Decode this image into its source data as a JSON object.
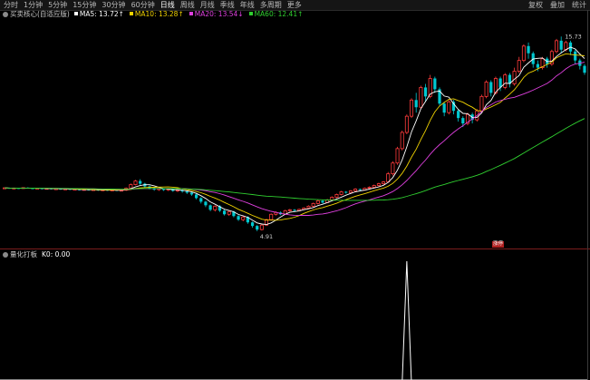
{
  "toolbar": {
    "timeframes": [
      "分时",
      "1分钟",
      "5分钟",
      "15分钟",
      "30分钟",
      "60分钟",
      "日线",
      "周线",
      "月线",
      "季线",
      "年线",
      "多周期",
      "更多"
    ],
    "active_index": 6,
    "right_buttons": [
      "复权",
      "叠加",
      "统计"
    ]
  },
  "main_legend": {
    "title": "买卖核心(自适应版)",
    "items": [
      {
        "label": "MA5: 13.72",
        "arrow": "↑",
        "color": "#ffffff"
      },
      {
        "label": "MA10: 13.28",
        "arrow": "↑",
        "color": "#f0d200"
      },
      {
        "label": "MA20: 13.54",
        "arrow": "↓",
        "color": "#e040e0"
      },
      {
        "label": "MA60: 12.41",
        "arrow": "↑",
        "color": "#30d030"
      }
    ]
  },
  "sub_legend": {
    "title": "量化打板",
    "value": "K0: 0.00"
  },
  "annotations": {
    "high_label": "15.73",
    "low_label": "4.91",
    "signal_badge": "涨停"
  },
  "colors": {
    "up": "#ff3b3b",
    "down": "#00c8d0",
    "ma5": "#ffffff",
    "ma10": "#f0d200",
    "ma20": "#e040e0",
    "ma60": "#30d030",
    "background": "#000000"
  },
  "chart_data": {
    "type": "candlestick",
    "price_range": [
      4.2,
      16.4
    ],
    "candles": [
      [
        7.3,
        7.32,
        7.26,
        7.34
      ],
      [
        7.32,
        7.29,
        7.27,
        7.34
      ],
      [
        7.29,
        7.31,
        7.27,
        7.33
      ],
      [
        7.31,
        7.28,
        7.26,
        7.32
      ],
      [
        7.28,
        7.33,
        7.27,
        7.35
      ],
      [
        7.33,
        7.3,
        7.28,
        7.35
      ],
      [
        7.3,
        7.27,
        7.25,
        7.31
      ],
      [
        7.27,
        7.3,
        7.25,
        7.32
      ],
      [
        7.3,
        7.26,
        7.24,
        7.31
      ],
      [
        7.26,
        7.29,
        7.24,
        7.3
      ],
      [
        7.29,
        7.25,
        7.23,
        7.3
      ],
      [
        7.25,
        7.27,
        7.22,
        7.29
      ],
      [
        7.27,
        7.23,
        7.21,
        7.28
      ],
      [
        7.23,
        7.26,
        7.21,
        7.27
      ],
      [
        7.26,
        7.22,
        7.2,
        7.27
      ],
      [
        7.22,
        7.24,
        7.19,
        7.26
      ],
      [
        7.24,
        7.2,
        7.18,
        7.25
      ],
      [
        7.2,
        7.23,
        7.18,
        7.24
      ],
      [
        7.23,
        7.19,
        7.17,
        7.24
      ],
      [
        7.19,
        7.22,
        7.17,
        7.23
      ],
      [
        7.22,
        7.18,
        7.15,
        7.23
      ],
      [
        7.18,
        7.21,
        7.16,
        7.22
      ],
      [
        7.21,
        7.17,
        7.15,
        7.22
      ],
      [
        7.17,
        7.2,
        7.14,
        7.21
      ],
      [
        7.2,
        7.16,
        7.14,
        7.21
      ],
      [
        7.16,
        7.19,
        7.13,
        7.2
      ],
      [
        7.19,
        7.3,
        7.15,
        7.34
      ],
      [
        7.3,
        7.5,
        7.26,
        7.56
      ],
      [
        7.5,
        7.7,
        7.46,
        7.76
      ],
      [
        7.7,
        7.55,
        7.48,
        7.8
      ],
      [
        7.55,
        7.4,
        7.35,
        7.6
      ],
      [
        7.4,
        7.3,
        7.24,
        7.45
      ],
      [
        7.3,
        7.22,
        7.16,
        7.35
      ],
      [
        7.22,
        7.28,
        7.15,
        7.32
      ],
      [
        7.28,
        7.2,
        7.15,
        7.3
      ],
      [
        7.2,
        7.25,
        7.14,
        7.28
      ],
      [
        7.25,
        7.15,
        7.1,
        7.27
      ],
      [
        7.15,
        7.2,
        7.08,
        7.22
      ],
      [
        7.2,
        7.12,
        7.05,
        7.24
      ],
      [
        7.12,
        7.05,
        6.98,
        7.16
      ],
      [
        7.05,
        6.95,
        6.88,
        7.1
      ],
      [
        6.95,
        6.75,
        6.68,
        7.0
      ],
      [
        6.75,
        6.55,
        6.45,
        6.8
      ],
      [
        6.55,
        6.35,
        6.25,
        6.6
      ],
      [
        6.35,
        6.1,
        6.02,
        6.4
      ],
      [
        6.1,
        6.3,
        6.0,
        6.35
      ],
      [
        6.3,
        6.05,
        5.98,
        6.36
      ],
      [
        6.05,
        5.85,
        5.78,
        6.1
      ],
      [
        5.85,
        6.0,
        5.76,
        6.05
      ],
      [
        6.0,
        5.75,
        5.68,
        6.04
      ],
      [
        5.75,
        5.55,
        5.48,
        5.8
      ],
      [
        5.55,
        5.7,
        5.46,
        5.76
      ],
      [
        5.7,
        5.4,
        5.32,
        5.74
      ],
      [
        5.4,
        5.2,
        5.1,
        5.45
      ],
      [
        5.2,
        5.0,
        4.91,
        5.25
      ],
      [
        5.0,
        5.25,
        4.95,
        5.3
      ],
      [
        5.25,
        5.55,
        5.2,
        5.6
      ],
      [
        5.55,
        5.85,
        5.5,
        5.9
      ],
      [
        5.85,
        5.95,
        5.78,
        6.02
      ],
      [
        5.95,
        5.85,
        5.8,
        6.0
      ],
      [
        5.85,
        6.05,
        5.82,
        6.1
      ],
      [
        6.05,
        6.1,
        6.0,
        6.15
      ],
      [
        6.1,
        6.05,
        6.0,
        6.14
      ],
      [
        6.05,
        6.12,
        6.02,
        6.16
      ],
      [
        6.12,
        6.2,
        6.08,
        6.24
      ],
      [
        6.2,
        6.3,
        6.15,
        6.35
      ],
      [
        6.3,
        6.45,
        6.25,
        6.5
      ],
      [
        6.45,
        6.6,
        6.4,
        6.65
      ],
      [
        6.6,
        6.5,
        6.45,
        6.66
      ],
      [
        6.5,
        6.65,
        6.47,
        6.7
      ],
      [
        6.65,
        6.8,
        6.6,
        6.85
      ],
      [
        6.8,
        6.95,
        6.75,
        7.0
      ],
      [
        6.95,
        7.1,
        6.9,
        7.15
      ],
      [
        7.1,
        7.05,
        7.0,
        7.14
      ],
      [
        7.05,
        7.15,
        7.02,
        7.2
      ],
      [
        7.15,
        7.25,
        7.1,
        7.3
      ],
      [
        7.25,
        7.2,
        7.15,
        7.28
      ],
      [
        7.2,
        7.3,
        7.17,
        7.34
      ],
      [
        7.3,
        7.35,
        7.25,
        7.4
      ],
      [
        7.35,
        7.45,
        7.3,
        7.5
      ],
      [
        7.45,
        7.55,
        7.4,
        7.6
      ],
      [
        7.55,
        7.65,
        7.5,
        7.7
      ],
      [
        7.65,
        8.1,
        7.6,
        8.2
      ],
      [
        8.1,
        8.7,
        8.0,
        8.8
      ],
      [
        8.7,
        9.5,
        8.6,
        9.6
      ],
      [
        9.5,
        10.4,
        9.4,
        10.5
      ],
      [
        10.4,
        11.3,
        10.3,
        11.4
      ],
      [
        11.3,
        12.2,
        11.2,
        12.3
      ],
      [
        12.2,
        11.8,
        11.5,
        12.6
      ],
      [
        11.8,
        12.9,
        11.7,
        13.0
      ],
      [
        12.9,
        12.4,
        12.1,
        13.1
      ],
      [
        12.4,
        13.4,
        12.3,
        13.6
      ],
      [
        13.4,
        12.8,
        12.6,
        13.5
      ],
      [
        12.8,
        12.0,
        11.9,
        12.9
      ],
      [
        12.0,
        11.5,
        11.3,
        12.1
      ],
      [
        11.5,
        12.1,
        11.4,
        12.2
      ],
      [
        12.1,
        11.6,
        11.4,
        12.2
      ],
      [
        11.6,
        11.2,
        11.0,
        11.7
      ],
      [
        11.2,
        10.9,
        10.7,
        11.3
      ],
      [
        10.9,
        11.4,
        10.8,
        11.5
      ],
      [
        11.4,
        11.1,
        10.9,
        11.5
      ],
      [
        11.1,
        11.6,
        11.0,
        11.7
      ],
      [
        11.6,
        12.4,
        11.5,
        12.5
      ],
      [
        12.4,
        13.2,
        12.3,
        13.3
      ],
      [
        13.2,
        12.6,
        12.4,
        13.3
      ],
      [
        12.6,
        13.4,
        12.5,
        13.5
      ],
      [
        13.4,
        12.9,
        12.7,
        13.5
      ],
      [
        12.9,
        13.6,
        12.8,
        13.7
      ],
      [
        13.6,
        13.1,
        12.9,
        13.7
      ],
      [
        13.1,
        13.8,
        13.0,
        14.0
      ],
      [
        13.8,
        14.4,
        13.7,
        14.6
      ],
      [
        14.4,
        15.2,
        14.3,
        15.3
      ],
      [
        15.2,
        14.8,
        14.5,
        15.4
      ],
      [
        14.8,
        14.2,
        14.0,
        14.9
      ],
      [
        14.2,
        14.0,
        13.8,
        14.4
      ],
      [
        14.0,
        14.5,
        13.9,
        14.6
      ],
      [
        14.5,
        14.2,
        14.0,
        14.6
      ],
      [
        14.2,
        14.9,
        14.1,
        15.0
      ],
      [
        14.9,
        15.5,
        14.8,
        15.6
      ],
      [
        15.5,
        15.0,
        14.8,
        15.73
      ],
      [
        15.0,
        15.4,
        14.9,
        15.5
      ],
      [
        15.4,
        14.9,
        14.7,
        15.5
      ],
      [
        14.9,
        14.4,
        14.2,
        15.0
      ],
      [
        14.4,
        14.1,
        13.9,
        14.5
      ],
      [
        14.1,
        13.72,
        13.6,
        14.2
      ]
    ],
    "sub_series": {
      "name": "K0",
      "range": [
        0,
        1
      ],
      "spike_index": 86,
      "spike_value": 1
    }
  }
}
